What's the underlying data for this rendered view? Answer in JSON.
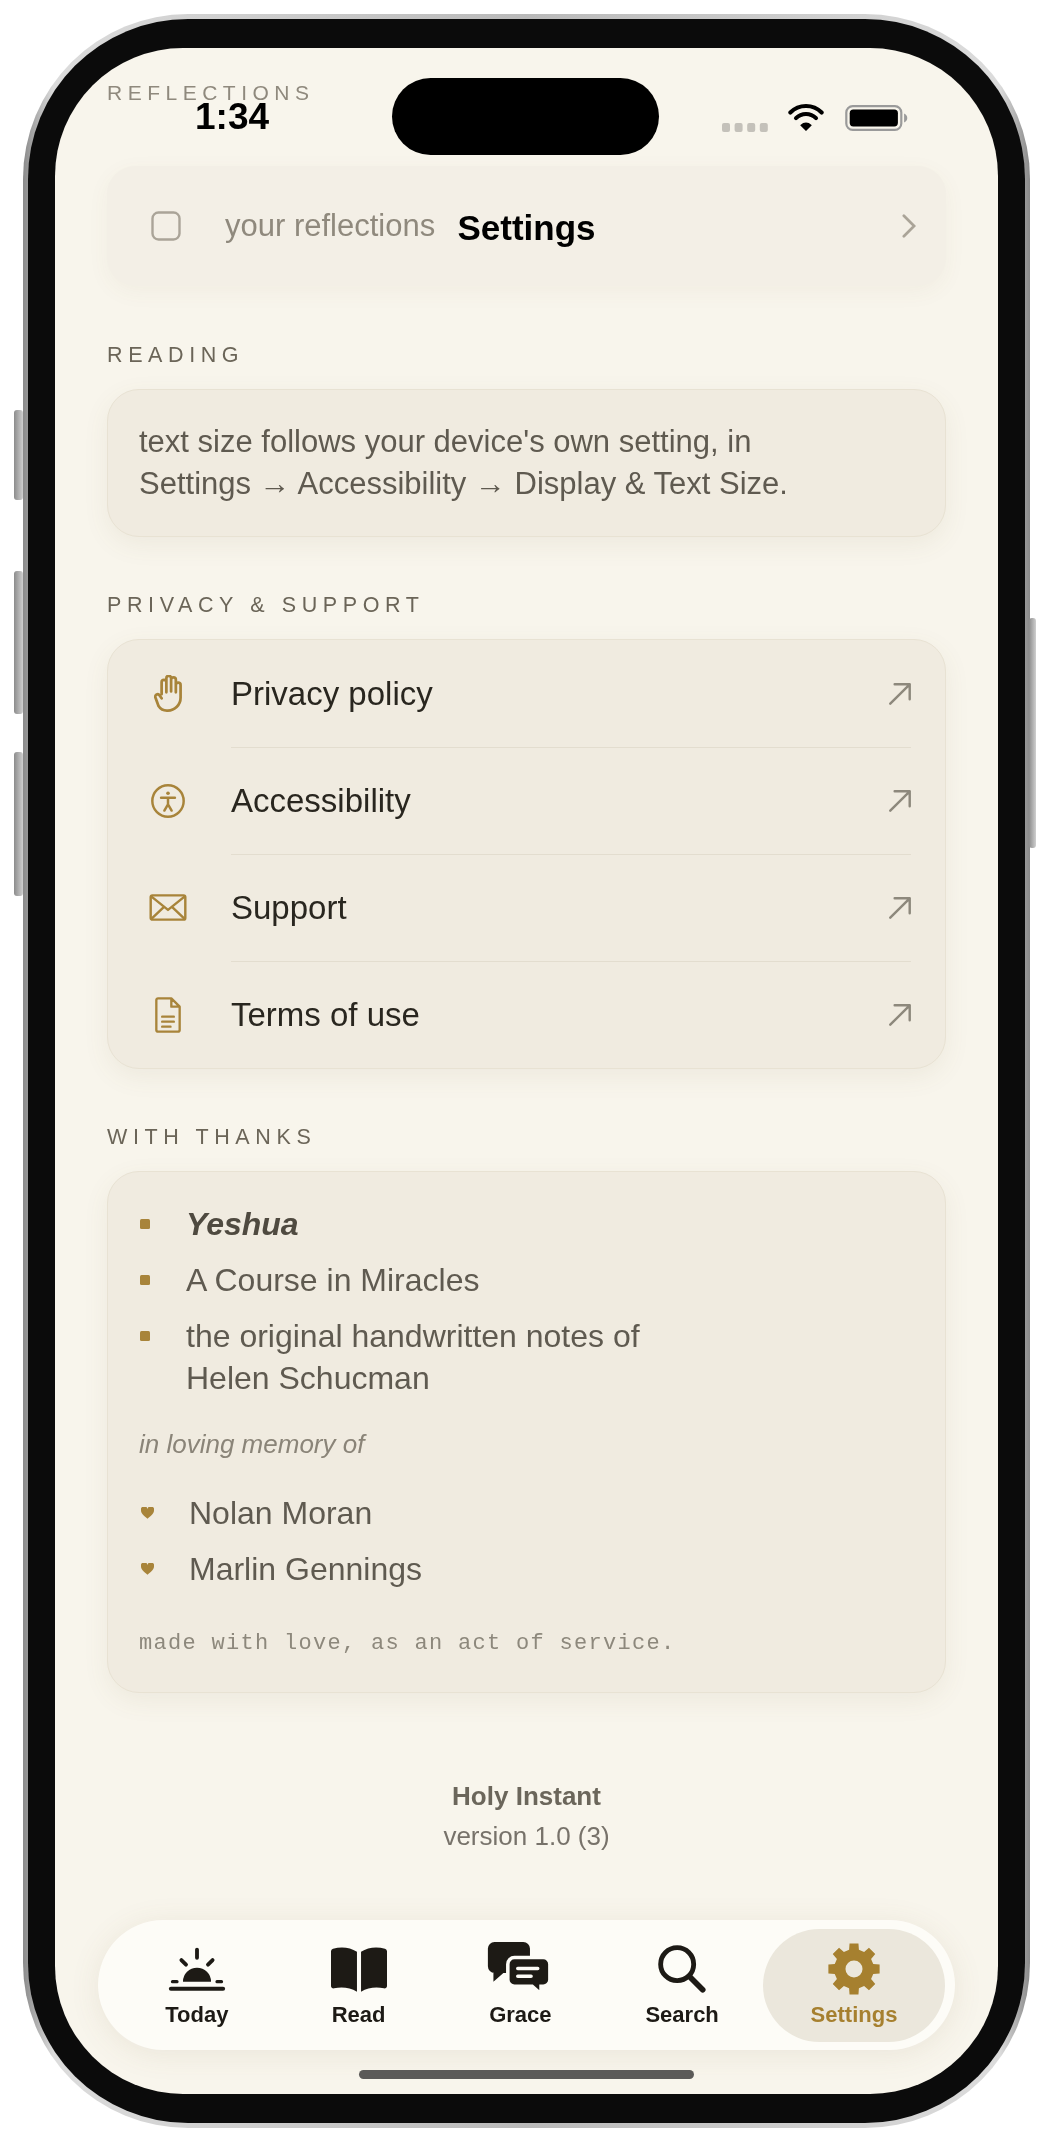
{
  "status_bar": {
    "time": "1:34"
  },
  "navigation_bar": {
    "title": "Settings"
  },
  "scrolled_under": {
    "section_label": "REFLECTIONS",
    "row_label": "your reflections"
  },
  "reading": {
    "label": "READING",
    "note": "text size follows your device's own setting, in\nSettings → Accessibility → Display & Text Size."
  },
  "privacy_support": {
    "label": "PRIVACY & SUPPORT",
    "links": [
      {
        "label": "Privacy policy"
      },
      {
        "label": "Accessibility"
      },
      {
        "label": "Support"
      },
      {
        "label": "Terms of use"
      }
    ]
  },
  "with_thanks": {
    "label": "WITH THANKS",
    "thanks": [
      {
        "text": "Yeshua",
        "emphasis": true
      },
      {
        "text": "A Course in Miracles",
        "emphasis": false
      },
      {
        "text": "the original handwritten notes of\nHelen Schucman",
        "emphasis": false
      }
    ],
    "memorial_label": "in loving memory of",
    "memorial": [
      "Nolan Moran",
      "Marlin Gennings"
    ],
    "closing": "made with love, as an act of service."
  },
  "footer": {
    "app_name": "Holy Instant",
    "version": "version 1.0 (3)"
  },
  "tab_bar": {
    "tabs": [
      {
        "label": "Today",
        "selected": false
      },
      {
        "label": "Read",
        "selected": false
      },
      {
        "label": "Grace",
        "selected": false
      },
      {
        "label": "Search",
        "selected": false
      },
      {
        "label": "Settings",
        "selected": true
      }
    ]
  }
}
